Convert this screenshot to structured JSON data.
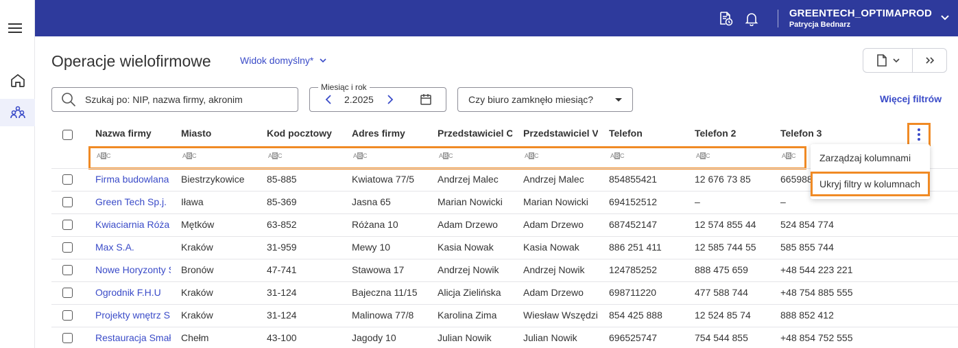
{
  "topbar": {
    "company_name": "GREENTECH_OPTIMAPROD",
    "user_name": "Patrycja Bednarz",
    "brand_color": "#2e3a9c"
  },
  "page": {
    "title": "Operacje wielofirmowe",
    "view_label": "Widok domyślny*"
  },
  "filters": {
    "search_placeholder": "Szukaj po: NIP, nazwa firmy, akronim",
    "month_label": "Miesiąc i rok",
    "month_value": "2.2025",
    "office_closed_label": "Czy biuro zamknęło miesiąc?",
    "more_filters": "Więcej filtrów",
    "abc_label": "ABC"
  },
  "columns": [
    "Nazwa firmy",
    "Miasto",
    "Kod pocztowy",
    "Adres firmy",
    "Przedstawiciel CI",
    "Przedstawiciel VA",
    "Telefon",
    "Telefon 2",
    "Telefon 3"
  ],
  "rows": [
    [
      "Firma budowlana",
      "Biestrzykowice",
      "85-885",
      "Kwiatowa 77/5",
      "Andrzej Malec",
      "Andrzej Malec",
      "854855421",
      "12 676 73 85",
      "665988"
    ],
    [
      "Green Tech Sp.j.",
      "Iława",
      "85-369",
      "Jasna 65",
      "Marian Nowicki",
      "Marian Nowicki",
      "694152512",
      "–",
      "–"
    ],
    [
      "Kwiaciarnia Róża",
      "Mętków",
      "63-852",
      "Różana 10",
      "Adam Drzewo",
      "Adam Drzewo",
      "687452147",
      "12 574 855 44",
      "524 854 774"
    ],
    [
      "Max S.A.",
      "Kraków",
      "31-959",
      "Mewy 10",
      "Kasia Nowak",
      "Kasia Nowak",
      "886 251 411",
      "12 585 744 55",
      "585 855 744"
    ],
    [
      "Nowe Horyzonty S",
      "Bronów",
      "47-741",
      "Stawowa 17",
      "Andrzej Nowik",
      "Andrzej Nowik",
      "124785252",
      "888 475 659",
      "+48 544 223 221"
    ],
    [
      "Ogrodnik F.H.U",
      "Kraków",
      "31-124",
      "Bajeczna 11/15",
      "Alicja Zielińska",
      "Adam Drzewo",
      "698711220",
      "477 588 744",
      "+48 754 885 555"
    ],
    [
      "Projekty wnętrz S",
      "Kraków",
      "31-124",
      "Malinowa 77/8",
      "Karolina Zima",
      "Wiesław Wszędzi",
      "854 425 888",
      "12 524 85 74",
      "888 852 412"
    ],
    [
      "Restauracja Smał",
      "Chełm",
      "43-100",
      "Jagody 10",
      "Julian Nowik",
      "Julian Nowik",
      "696525747",
      "754 544 855",
      "+48 854 752 555"
    ]
  ],
  "column_menu": {
    "items": [
      "Zarządzaj kolumnami",
      "Ukryj filtry w kolumnach"
    ]
  },
  "accent_color": "#3a4bc8",
  "highlight_color": "#f08a24"
}
